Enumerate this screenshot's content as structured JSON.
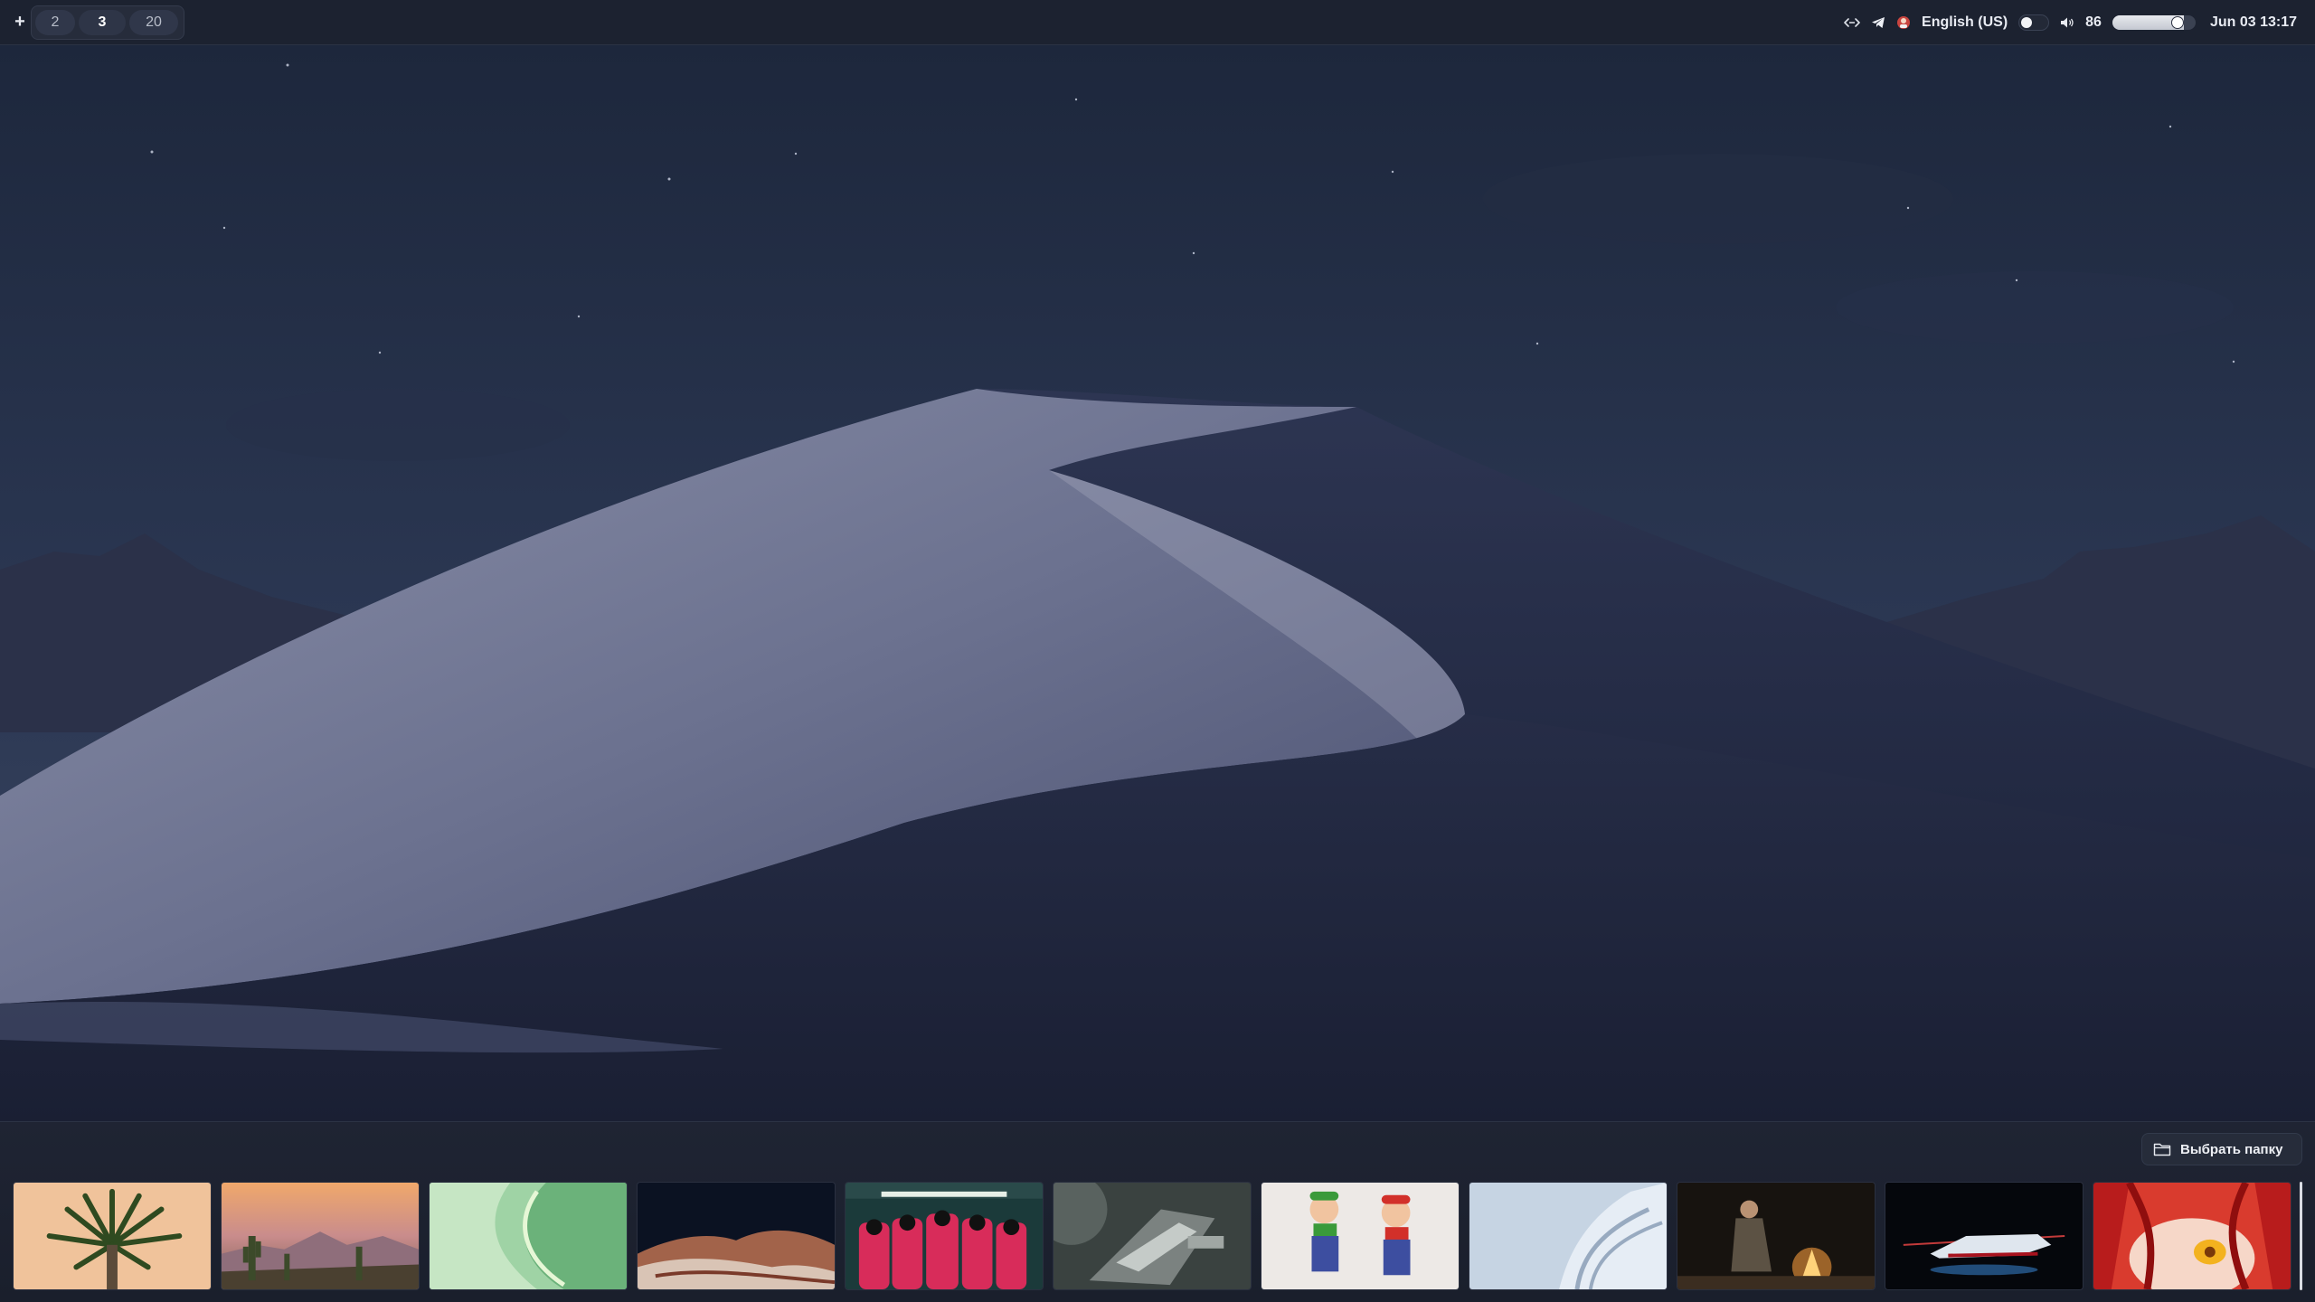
{
  "topbar": {
    "add_label": "+",
    "workspaces": [
      {
        "label": "2",
        "active": false
      },
      {
        "label": "3",
        "active": true
      },
      {
        "label": "20",
        "active": false
      }
    ],
    "tray": {
      "icons": [
        "network-arrows-icon",
        "telegram-icon",
        "app-tray-icon"
      ],
      "keyboard_layout": "English (US)",
      "toggle_on": false,
      "volume": 86,
      "volume_fraction": 0.86,
      "datetime": "Jun 03 13:17"
    }
  },
  "wallpaper": {
    "description_icon": "desert-dune-night-wallpaper"
  },
  "picker": {
    "folder_button_label": "Выбрать папку",
    "folder_icon": "folder-icon",
    "thumbnails": [
      {
        "icon": "palm-tree-wallpaper"
      },
      {
        "icon": "desert-cactus-sunset-wallpaper"
      },
      {
        "icon": "green-abstract-wallpaper"
      },
      {
        "icon": "canyon-rock-night-wallpaper"
      },
      {
        "icon": "squid-game-guards-wallpaper"
      },
      {
        "icon": "spaceship-wallpaper"
      },
      {
        "icon": "mario-luigi-wallpaper"
      },
      {
        "icon": "white-abstract-wave-wallpaper"
      },
      {
        "icon": "campfire-night-wallpaper"
      },
      {
        "icon": "hover-vehicle-night-wallpaper"
      },
      {
        "icon": "anime-red-hair-wallpaper"
      }
    ]
  }
}
